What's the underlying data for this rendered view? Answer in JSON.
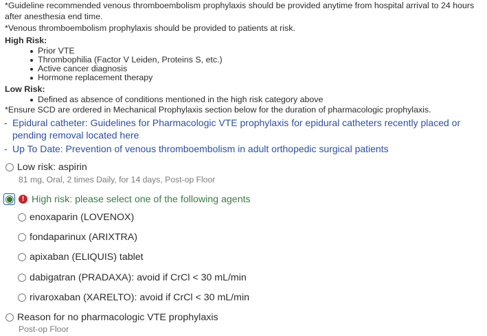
{
  "guideline": {
    "line1": "*Guideline recommended venous thromboembolism prophylaxis should be provided anytime from hospital arrival to 24 hours after anesthesia end time.",
    "line2": "*Venous thromboembolism prophylaxis should be provided to patients at risk.",
    "high_risk_heading": "High Risk:",
    "high_risk_items": [
      "Prior VTE",
      "Thrombophilia (Factor V Leiden, Proteins S, etc.)",
      "Active cancer diagnosis",
      "Hormone replacement therapy"
    ],
    "low_risk_heading": "Low Risk:",
    "low_risk_items": [
      "Defined as absence of conditions mentioned in the high risk category above"
    ],
    "scd_note": "*Ensure SCD are ordered in Mechanical Prophylaxis section below for the duration of pharmacologic prophylaxis."
  },
  "links": [
    {
      "dash": "-",
      "label": "Epidural catheter: Guidelines for Pharmacologic VTE prophylaxis for epidural catheters recently placed or pending removal located here"
    },
    {
      "dash": "-",
      "label": "Up To Date: Prevention of venous thromboembolism in adult orthopedic surgical patients"
    }
  ],
  "orders": {
    "low_risk": {
      "label": "Low risk: aspirin",
      "details": "81 mg, Oral, 2 times Daily,  for 14 days, Post-op Floor"
    },
    "high_risk": {
      "label": "High risk: please select one of the following agents",
      "alert_icon_glyph": "!",
      "agents": [
        "enoxaparin (LOVENOX)",
        "fondaparinux (ARIXTRA)",
        "apixaban (ELIQUIS) tablet",
        "dabigatran (PRADAXA): avoid if CrCl < 30 mL/min",
        "rivaroxaban (XARELTO): avoid if CrCl < 30 mL/min"
      ]
    },
    "no_pharm": {
      "label": "Reason for no pharmacologic VTE prophylaxis",
      "details": "Post-op Floor"
    }
  },
  "colors": {
    "link": "#2e4f9e",
    "selected_green": "#3b7a48",
    "alert_red": "#c4262e",
    "detail_gray": "#7b7b7b"
  },
  "icons": {
    "alert": "exclamation-circle-icon",
    "radio": "radio-button"
  }
}
